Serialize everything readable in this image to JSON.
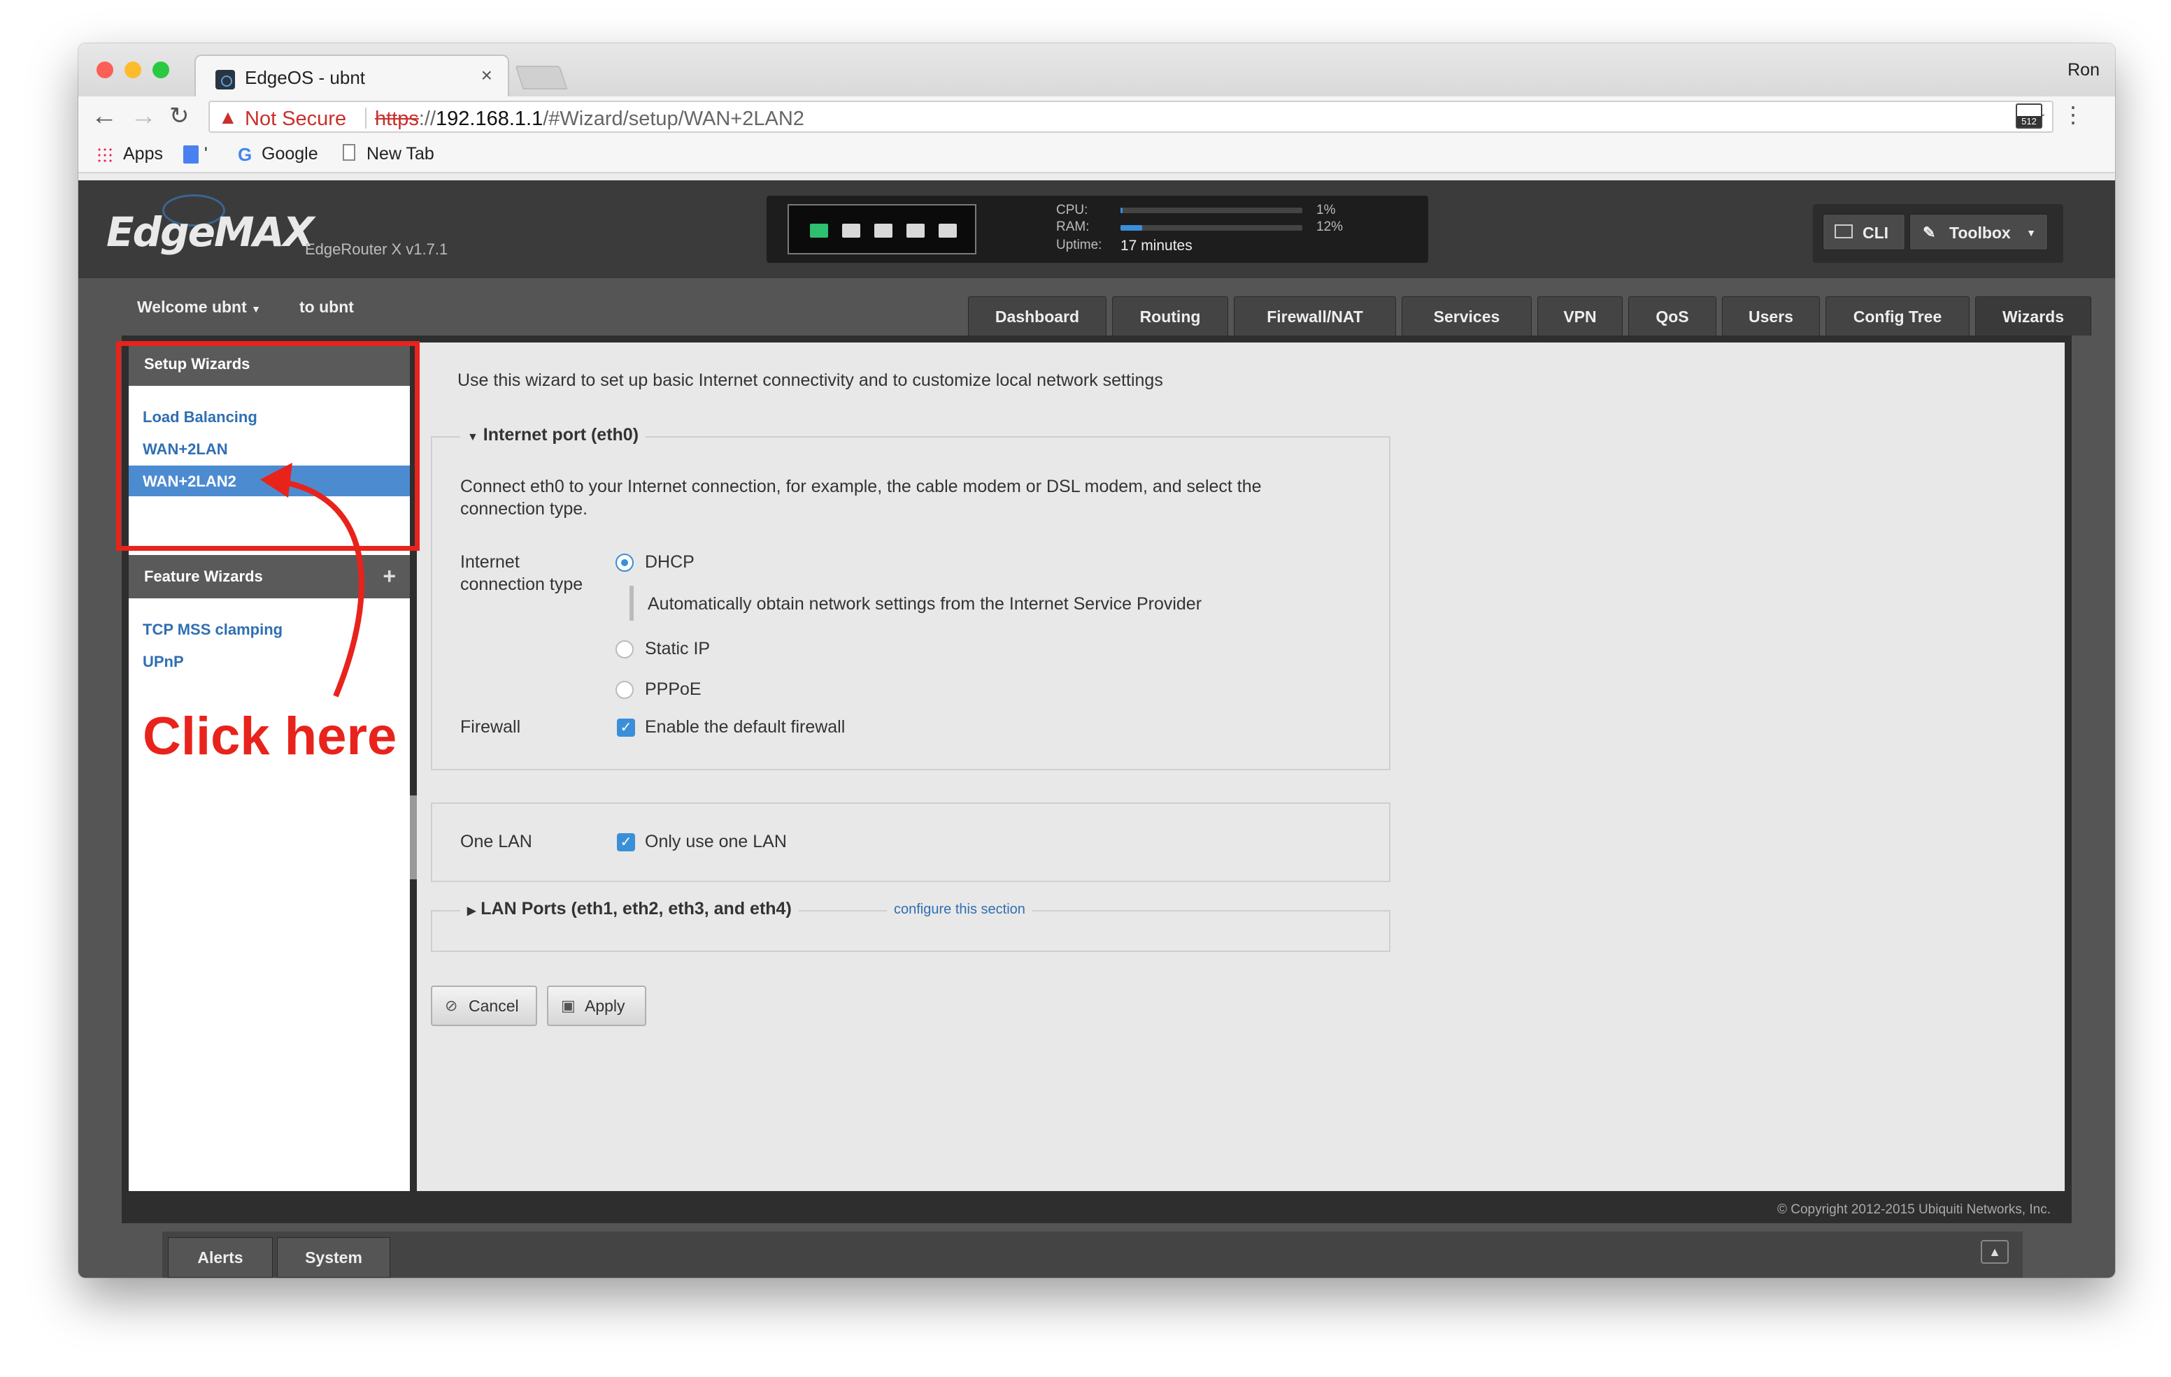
{
  "browser": {
    "tab_title": "EdgeOS - ubnt",
    "tab_close": "×",
    "profile_name": "Ron",
    "security_label": "Not Secure",
    "url_scheme": "https",
    "url_host": "192.168.1.1",
    "url_path": "/#Wizard/setup/WAN+2LAN2",
    "extension_badge": "512",
    "bookmarks": [
      "Apps",
      "'",
      "Google",
      "New Tab"
    ]
  },
  "header": {
    "logo": "EdgeMAX",
    "version": "EdgeRouter X v1.7.1",
    "cpu_label": "CPU:",
    "ram_label": "RAM:",
    "uptime_label": "Uptime:",
    "cpu_pct": "1%",
    "ram_pct": "12%",
    "cpu_fraction": 0.01,
    "ram_fraction": 0.12,
    "uptime": "17 minutes",
    "ports": [
      "on",
      "off",
      "off",
      "off",
      "off"
    ],
    "cli_label": "CLI",
    "toolbox_label": "Toolbox"
  },
  "userbar": {
    "welcome": "Welcome ubnt",
    "to_user": "to ubnt"
  },
  "nav_tabs": [
    "Dashboard",
    "Routing",
    "Firewall/NAT",
    "Services",
    "VPN",
    "QoS",
    "Users",
    "Config Tree",
    "Wizards"
  ],
  "sidebar": {
    "setup_title": "Setup Wizards",
    "setup_items": [
      "Load Balancing",
      "WAN+2LAN",
      "WAN+2LAN2"
    ],
    "feature_title": "Feature Wizards",
    "feature_items": [
      "TCP MSS clamping",
      "UPnP"
    ]
  },
  "wizard": {
    "intro": "Use this wizard to set up basic Internet connectivity and to customize local network settings",
    "internet_legend": "Internet port (eth0)",
    "internet_desc_1": "Connect eth0 to your Internet connection, for example, the cable modem or DSL modem, and select the",
    "internet_desc_2": "connection type.",
    "conn_type_label_1": "Internet",
    "conn_type_label_2": "connection type",
    "opt_dhcp": "DHCP",
    "dhcp_desc": "Automatically obtain network settings from the Internet Service Provider",
    "opt_static": "Static IP",
    "opt_pppoe": "PPPoE",
    "firewall_label": "Firewall",
    "firewall_option": "Enable the default firewall",
    "one_lan_label": "One LAN",
    "one_lan_option": "Only use one LAN",
    "lan_legend": "LAN Ports (eth1, eth2, eth3, and eth4)",
    "lan_configure": "configure this section",
    "cancel": "Cancel",
    "apply": "Apply"
  },
  "footer": {
    "copyright": "© Copyright 2012-2015 Ubiquiti Networks, Inc.",
    "alerts": "Alerts",
    "system": "System"
  },
  "annotation": {
    "text": "Click here",
    "color": "#e8231c"
  },
  "colors": {
    "accent": "#3a8fd8",
    "link": "#2f6fb3",
    "port_on": "#2fbf71",
    "port_off": "#d9d9d9"
  }
}
